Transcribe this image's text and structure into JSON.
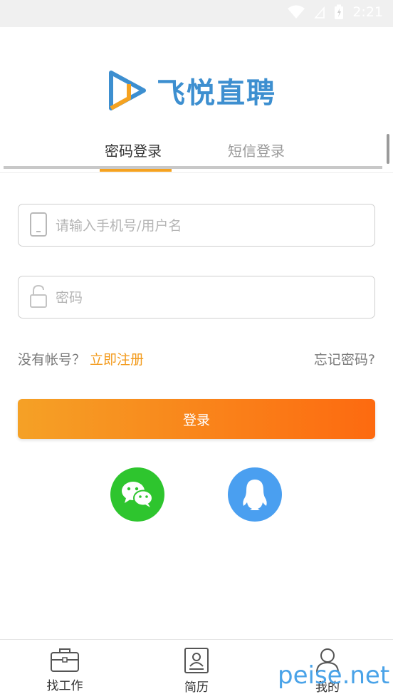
{
  "status_bar": {
    "time": "2:21"
  },
  "app": {
    "name": "飞悦直聘"
  },
  "tabs": [
    {
      "label": "密码登录",
      "active": true
    },
    {
      "label": "短信登录",
      "active": false
    }
  ],
  "form": {
    "phone_placeholder": "请输入手机号/用户名",
    "password_placeholder": "密码"
  },
  "links": {
    "no_account": "没有帐号？",
    "register": "立即注册",
    "forgot": "忘记密码?"
  },
  "login_button": "登录",
  "social_login": [
    {
      "icon": "wechat-icon"
    },
    {
      "icon": "qq-icon"
    }
  ],
  "bottom_nav": [
    {
      "label": "找工作",
      "icon": "briefcase-icon"
    },
    {
      "label": "简历",
      "icon": "resume-icon"
    },
    {
      "label": "我的",
      "icon": "user-icon"
    }
  ],
  "watermark": "peise.net",
  "colors": {
    "accent": "#f5a220",
    "brand_blue": "#3d8fd0",
    "wechat": "#2ec52e",
    "qq": "#4a9ff0"
  }
}
